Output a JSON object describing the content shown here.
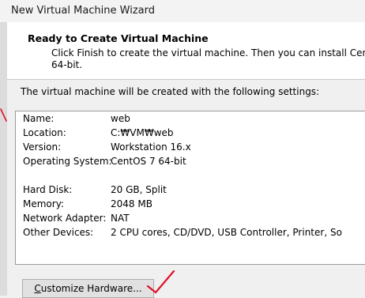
{
  "window": {
    "title": "New Virtual Machine Wizard"
  },
  "header": {
    "title": "Ready to Create Virtual Machine",
    "description": "Click Finish to create the virtual machine. Then you can install Cen\n64-bit."
  },
  "intro_text": "The virtual machine will be created with the following settings:",
  "settings": [
    {
      "label": "Name:",
      "value": "web"
    },
    {
      "label": "Location:",
      "value": "C:₩VM₩web"
    },
    {
      "label": "Version:",
      "value": "Workstation 16.x"
    },
    {
      "label": "Operating System:",
      "value": "CentOS 7 64-bit"
    },
    {
      "label": "Hard Disk:",
      "value": "20 GB, Split"
    },
    {
      "label": "Memory:",
      "value": "2048 MB"
    },
    {
      "label": "Network Adapter:",
      "value": "NAT"
    },
    {
      "label": "Other Devices:",
      "value": "2 CPU cores, CD/DVD, USB Controller, Printer, So"
    }
  ],
  "buttons": {
    "customize_mnemonic": "C",
    "customize_rest": "ustomize Hardware..."
  },
  "colors": {
    "annotation": "#e0102a"
  }
}
